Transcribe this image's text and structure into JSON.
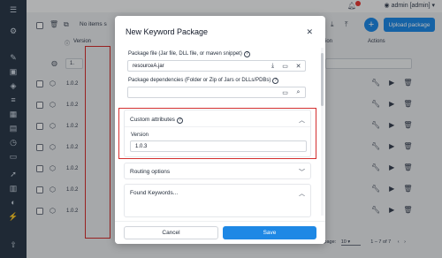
{
  "topbar": {
    "user": "admin [admin]",
    "notification_count": "1"
  },
  "sidebar": {
    "items": [
      "menu-icon",
      "settings-icon",
      "edit-icon",
      "package-icon",
      "cube-icon",
      "list-icon",
      "grid-icon",
      "clipboard-icon",
      "history-icon",
      "folder-icon",
      "rocket-icon",
      "archive-icon",
      "badge-icon",
      "plug-icon",
      "upload-icon"
    ]
  },
  "toolbar": {
    "no_items_text": "No items s",
    "upload_label": "Upload package",
    "plus_label": "+"
  },
  "table": {
    "version_header": "Version",
    "actions_header": "Actions",
    "cut_header": "ion",
    "filter_value": "1.",
    "rows": [
      "1.0.2",
      "1.0.2",
      "1.0.2",
      "1.0.2",
      "1.0.2",
      "1.0.2",
      "1.0.2"
    ],
    "per_page_label": "er page:",
    "per_page_value": "10",
    "range": "1 – 7 of 7"
  },
  "modal": {
    "title": "New Keyword Package",
    "package_file_label": "Package file (Jar file, DLL file, or maven snippet)",
    "package_file_value": "resourceA.jar",
    "package_dep_label": "Package dependencies (Folder or Zip of Jars or DLLs/PDBs)",
    "package_dep_value": "",
    "custom_attr_title": "Custom attributes",
    "version_label": "Version",
    "version_value": "1.0.3",
    "routing_title": "Routing options",
    "found_keywords_title": "Found Keywords...",
    "cancel_label": "Cancel",
    "save_label": "Save"
  },
  "colors": {
    "accent": "#1e88e5",
    "highlight": "#d32f2f",
    "sidebar": "#2b3a4a"
  }
}
